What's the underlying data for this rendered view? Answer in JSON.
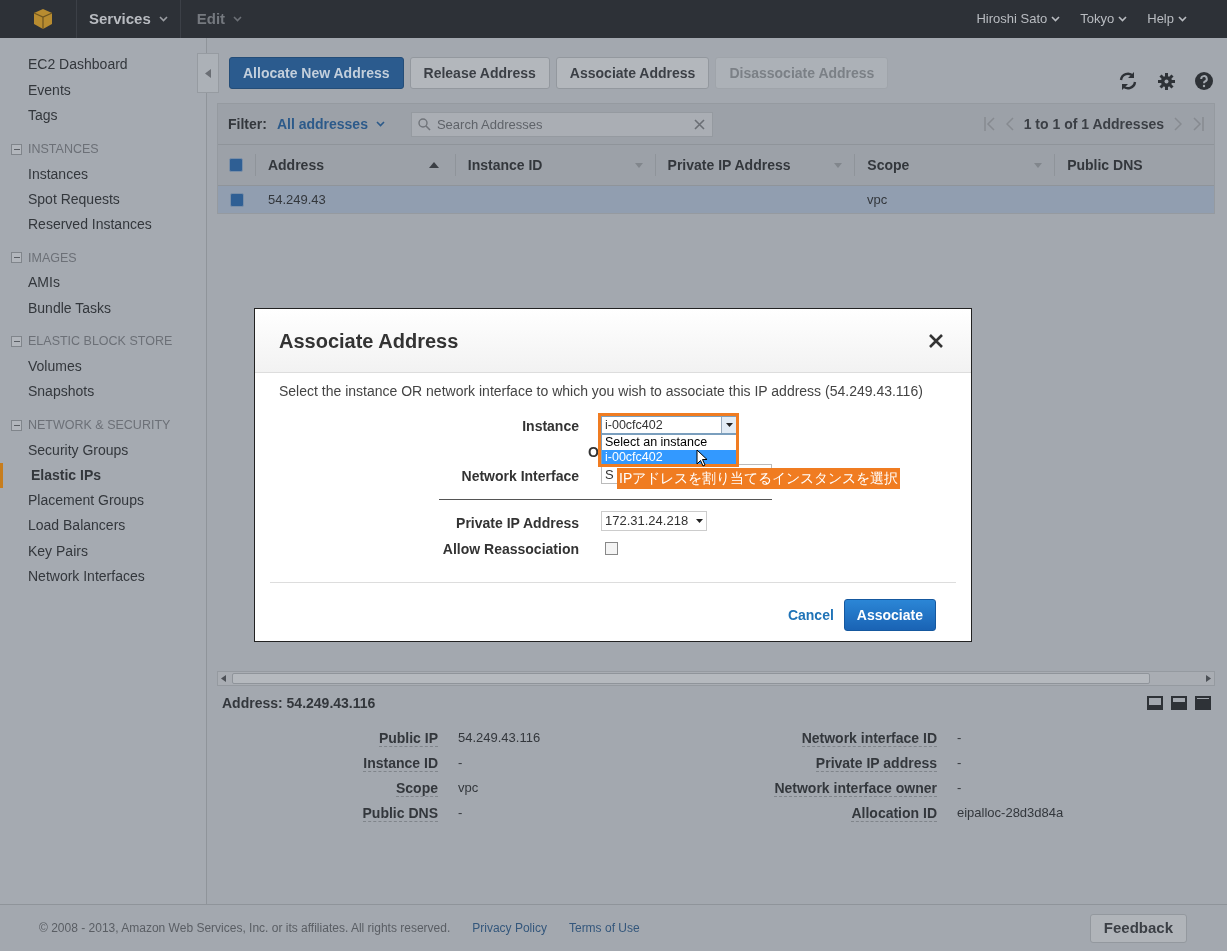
{
  "nav": {
    "services": "Services",
    "edit": "Edit",
    "user": "Hiroshi Sato",
    "region": "Tokyo",
    "help": "Help"
  },
  "sidebar": {
    "top_items": [
      {
        "label": "EC2 Dashboard",
        "selected": false
      },
      {
        "label": "Events",
        "selected": false
      },
      {
        "label": "Tags",
        "selected": false
      }
    ],
    "sections": [
      {
        "title": "INSTANCES",
        "expanded": true,
        "items": [
          {
            "label": "Instances",
            "selected": false
          },
          {
            "label": "Spot Requests",
            "selected": false
          },
          {
            "label": "Reserved Instances",
            "selected": false
          }
        ]
      },
      {
        "title": "IMAGES",
        "expanded": true,
        "items": [
          {
            "label": "AMIs",
            "selected": false
          },
          {
            "label": "Bundle Tasks",
            "selected": false
          }
        ]
      },
      {
        "title": "ELASTIC BLOCK STORE",
        "expanded": true,
        "items": [
          {
            "label": "Volumes",
            "selected": false
          },
          {
            "label": "Snapshots",
            "selected": false
          }
        ]
      },
      {
        "title": "NETWORK & SECURITY",
        "expanded": true,
        "items": [
          {
            "label": "Security Groups",
            "selected": false
          },
          {
            "label": "Elastic IPs",
            "selected": true
          },
          {
            "label": "Placement Groups",
            "selected": false
          },
          {
            "label": "Load Balancers",
            "selected": false
          },
          {
            "label": "Key Pairs",
            "selected": false
          },
          {
            "label": "Network Interfaces",
            "selected": false
          }
        ]
      }
    ]
  },
  "toolbar": {
    "buttons": [
      {
        "label": "Allocate New Address",
        "kind": "primary"
      },
      {
        "label": "Release Address",
        "kind": "default"
      },
      {
        "label": "Associate Address",
        "kind": "default"
      },
      {
        "label": "Disassociate Address",
        "kind": "disabled"
      }
    ]
  },
  "filter": {
    "label": "Filter:",
    "value": "All addresses",
    "search_placeholder": "Search Addresses",
    "pagination": "1 to 1 of 1 Addresses"
  },
  "table": {
    "all_checked": true,
    "columns": [
      {
        "label": "Address",
        "sorted": true
      },
      {
        "label": "Instance ID",
        "sorted": false
      },
      {
        "label": "Private IP Address",
        "sorted": false
      },
      {
        "label": "Scope",
        "sorted": false
      },
      {
        "label": "Public DNS"
      }
    ],
    "rows": [
      {
        "selected": true,
        "address": "54.249.43",
        "scope": "vpc"
      }
    ]
  },
  "details": {
    "title": "Address: 54.249.43.116",
    "left": [
      {
        "label": "Public IP",
        "value": "54.249.43.116"
      },
      {
        "label": "Instance ID",
        "value": "-"
      },
      {
        "label": "Scope",
        "value": "vpc"
      },
      {
        "label": "Public DNS",
        "value": "-"
      }
    ],
    "right": [
      {
        "label": "Network interface ID",
        "value": "-"
      },
      {
        "label": "Private IP address",
        "value": "-"
      },
      {
        "label": "Network interface owner",
        "value": "-"
      },
      {
        "label": "Allocation ID",
        "value": "eipalloc-28d3d84a"
      }
    ]
  },
  "dialog": {
    "title": "Associate Address",
    "description": "Select the instance OR network interface to which you wish to associate this IP address (54.249.43.116)",
    "instance": {
      "label": "Instance",
      "value": "i-00cfc402",
      "options": [
        {
          "label": "Select an instance",
          "selected": false
        },
        {
          "label": "i-00cfc402",
          "selected": true
        }
      ]
    },
    "or": "O",
    "network_interface": {
      "label": "Network Interface",
      "value": "S"
    },
    "private_ip": {
      "label": "Private IP Address",
      "value": "172.31.24.218"
    },
    "reassociation": {
      "label": "Allow Reassociation",
      "checked": false
    },
    "cancel": "Cancel",
    "submit": "Associate",
    "annotation": "IPアドレスを割り当てるインスタンスを選択"
  },
  "footer": {
    "copyright": "© 2008 - 2013, Amazon Web Services, Inc. or its affiliates. All rights reserved.",
    "links": [
      "Privacy Policy",
      "Terms of Use"
    ],
    "feedback": "Feedback"
  }
}
